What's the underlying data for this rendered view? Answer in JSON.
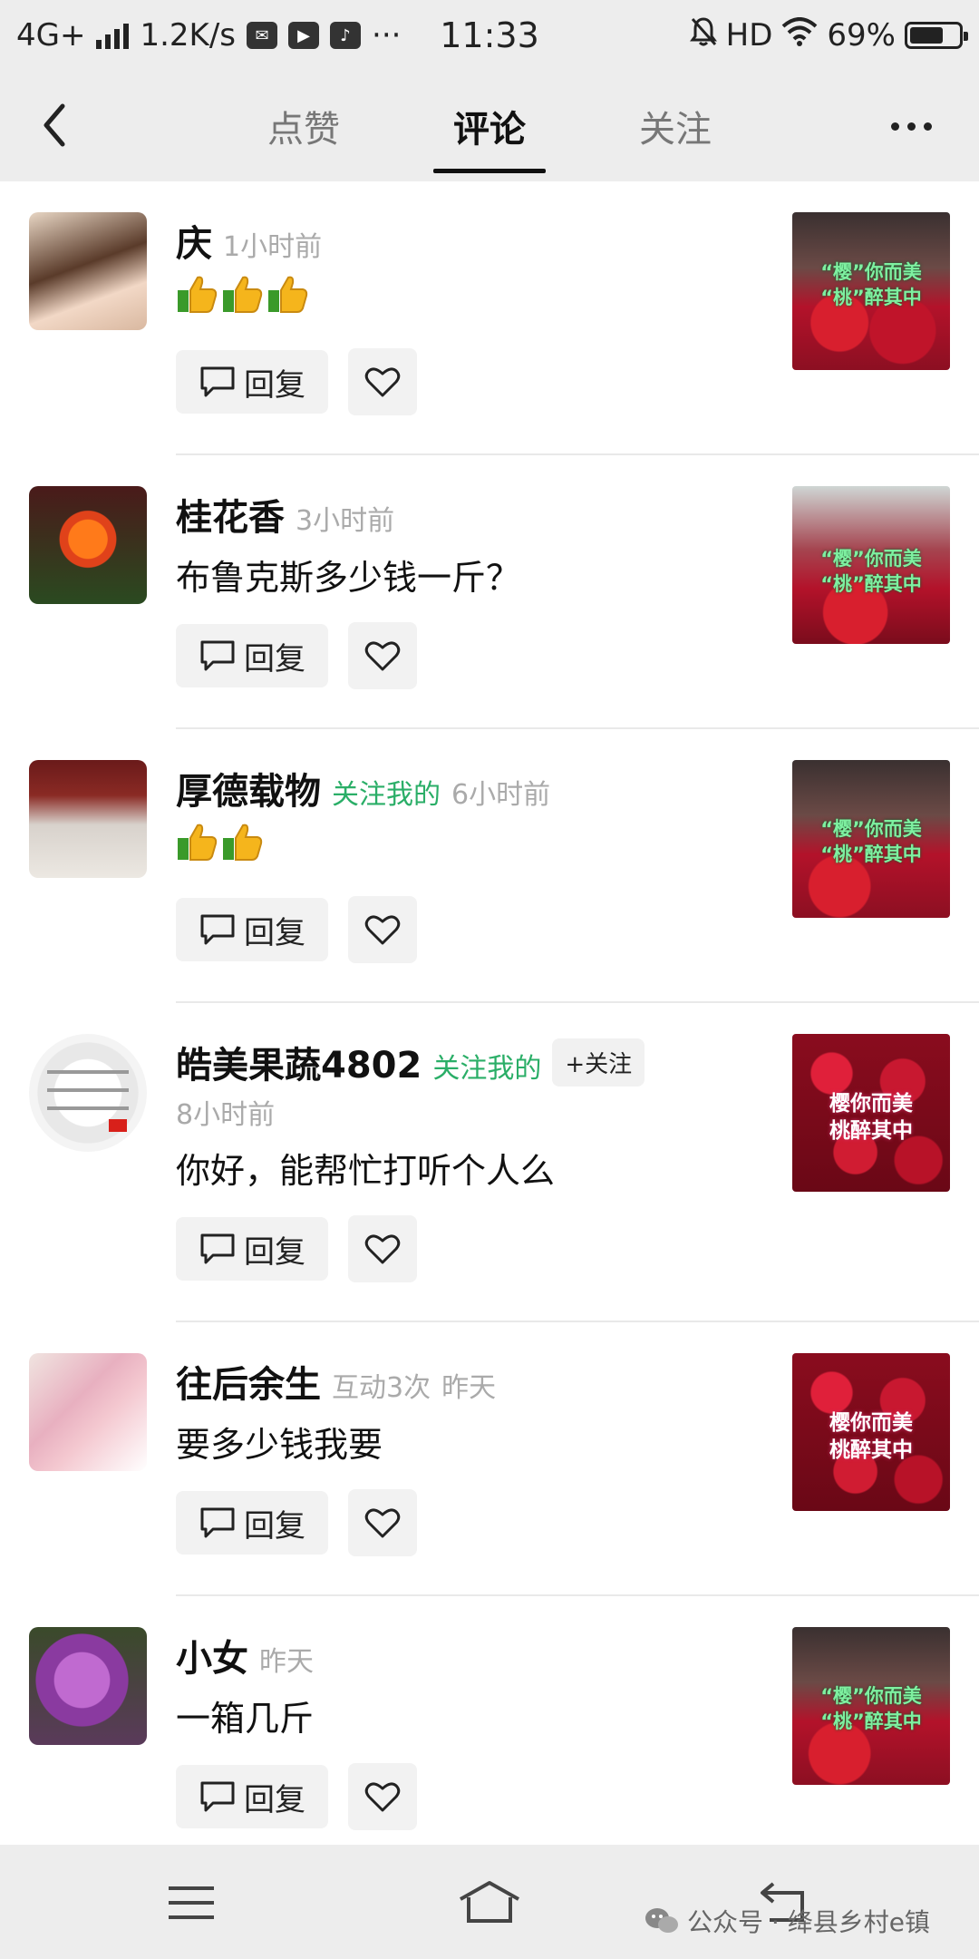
{
  "status_bar": {
    "network": "4G+",
    "speed": "1.2K/s",
    "time": "11:33",
    "hd": "HD",
    "battery": "69%",
    "battery_level": 0.69
  },
  "tabs": [
    {
      "label": "点赞",
      "active": false
    },
    {
      "label": "评论",
      "active": true
    },
    {
      "label": "关注",
      "active": false
    }
  ],
  "buttons": {
    "reply_label": "回复",
    "follow_btn_label": "+关注"
  },
  "comments": [
    {
      "name": "庆",
      "time": "1小时前",
      "text": "",
      "thumbs": 3
    },
    {
      "name": "桂花香",
      "time": "3小时前",
      "text": "布鲁克斯多少钱一斤？",
      "thumbs": 0
    },
    {
      "name": "厚德载物",
      "tag": "关注我的",
      "time": "6小时前",
      "text": "",
      "thumbs": 2
    },
    {
      "name": "皓美果蔬4802",
      "tag": "关注我的",
      "time": "8小时前",
      "text": "你好，能帮忙打听个人么",
      "thumbs": 0
    },
    {
      "name": "往后余生",
      "tag_gray": "互动3次",
      "time": "昨天",
      "text": "要多少钱我要",
      "thumbs": 0
    },
    {
      "name": "小女",
      "time": "昨天",
      "text": "一箱几斤",
      "thumbs": 0
    }
  ],
  "thumb_captions": {
    "a1": "“樱”你而美",
    "a2": "“桃”醉其中",
    "b1": "樱你而美",
    "b2": "桃醉其中"
  },
  "watermark": "公众号 · 绛县乡村e镇"
}
